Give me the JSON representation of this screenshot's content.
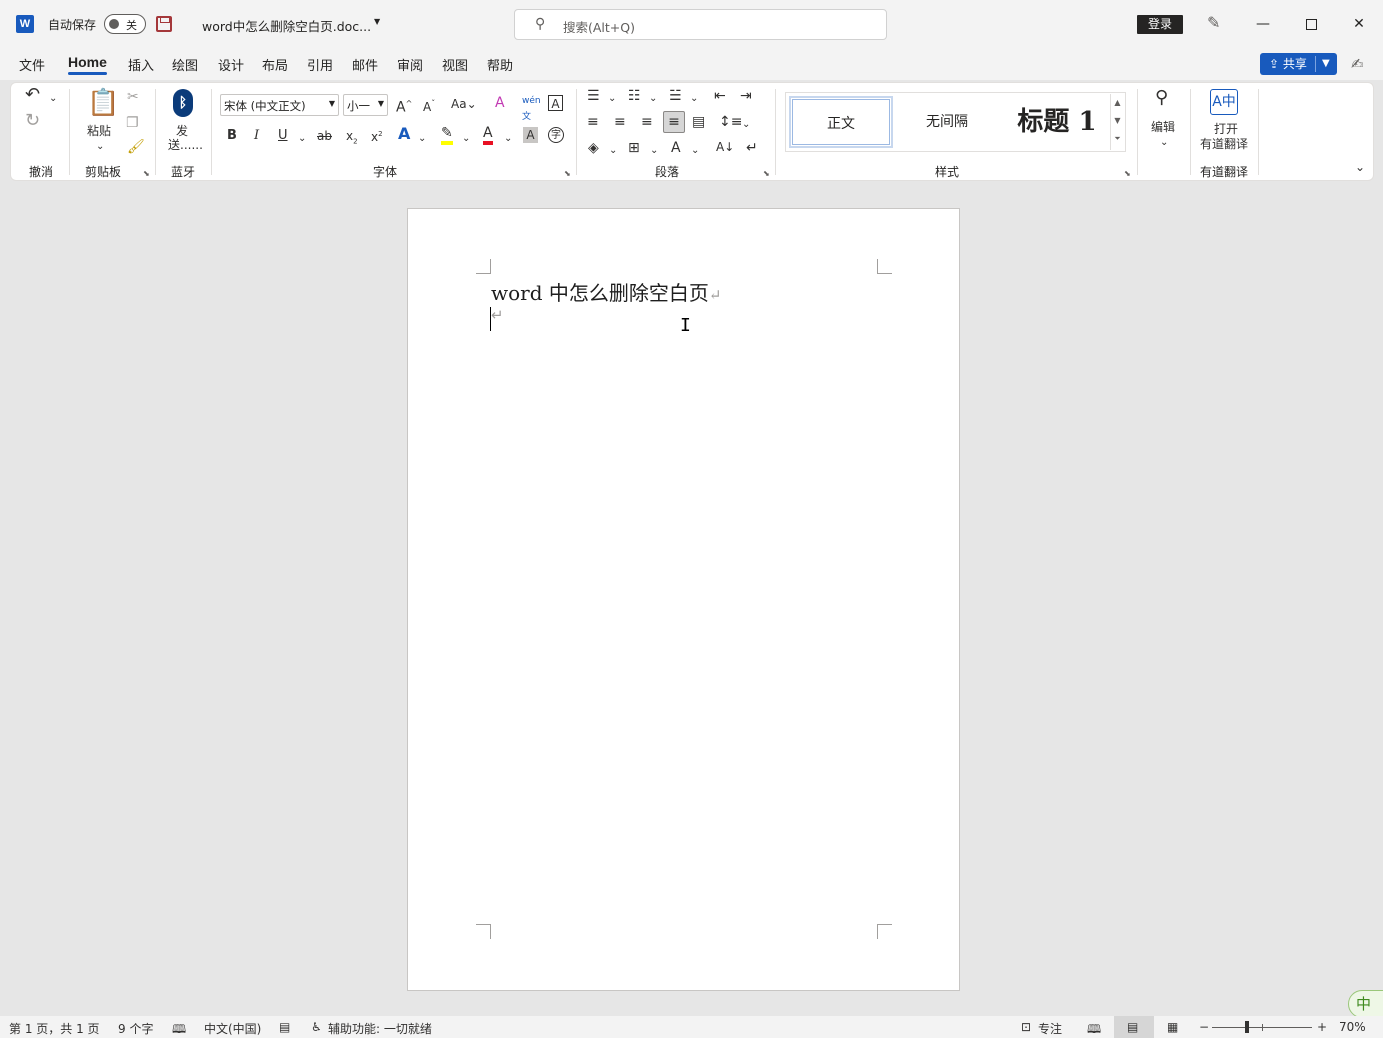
{
  "titlebar": {
    "app_logo": "W",
    "autosave_label": "自动保存",
    "autosave_state": "关",
    "doc_title": "word中怎么删除空白页.doc...",
    "search_placeholder": "搜索(Alt+Q)",
    "login_label": "登录",
    "icons": [
      "word-logo-icon",
      "save-icon",
      "search-icon",
      "pen-icon",
      "minimize-icon",
      "maximize-icon",
      "close-icon"
    ]
  },
  "tabs": {
    "items": [
      "文件",
      "Home",
      "插入",
      "绘图",
      "设计",
      "布局",
      "引用",
      "邮件",
      "审阅",
      "视图",
      "帮助"
    ],
    "active": "Home",
    "share_label": "共享"
  },
  "ribbon": {
    "groups": {
      "undo": "撤消",
      "clipboard": "剪贴板",
      "bluetooth": "蓝牙",
      "font": "字体",
      "paragraph": "段落",
      "styles": "样式",
      "translate": "有道翻译"
    },
    "paste_label": "粘贴",
    "send_label_1": "发",
    "send_label_2": "送......",
    "font_name": "宋体 (中文正文)",
    "font_size": "小一",
    "styles": [
      "正文",
      "无间隔",
      "标题 1"
    ],
    "edit_label": "编辑",
    "translate_label_1": "打开",
    "translate_label_2": "有道翻译",
    "accent_color": "#185abd",
    "highlight_color": "#ffff00",
    "font_color": "#e81123"
  },
  "document": {
    "line1": "word 中怎么删除空白页",
    "para_mark": "↵"
  },
  "ime": "中",
  "statusbar": {
    "page_info": "第 1 页，共 1 页",
    "word_count": "9 个字",
    "language": "中文(中国)",
    "accessibility": "辅助功能: 一切就绪",
    "focus": "专注",
    "zoom": "70%"
  }
}
